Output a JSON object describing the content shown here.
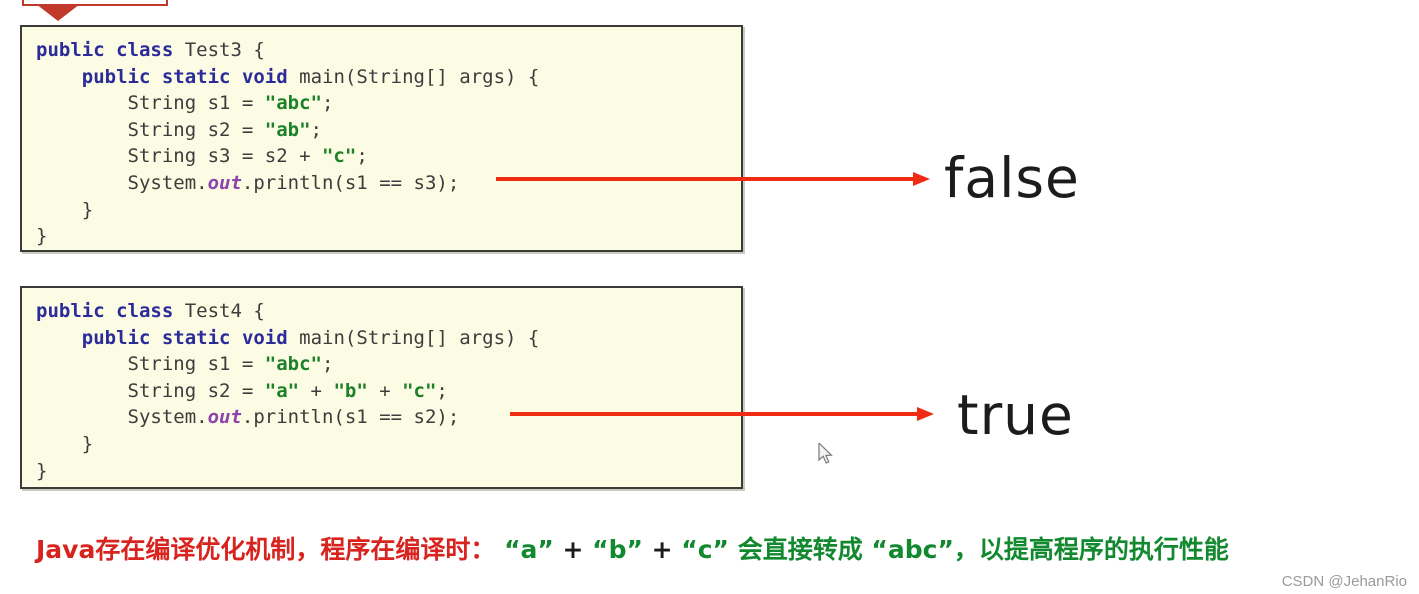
{
  "callout": {
    "name": "red-callout-banner"
  },
  "code_blocks": [
    {
      "id": "test3",
      "lines": [
        [
          {
            "t": "public",
            "c": "kw"
          },
          {
            "t": " ",
            "c": "pln"
          },
          {
            "t": "class",
            "c": "kw"
          },
          {
            "t": " Test3 {",
            "c": "pln"
          }
        ],
        [
          {
            "t": "    ",
            "c": "pln"
          },
          {
            "t": "public",
            "c": "kw"
          },
          {
            "t": " ",
            "c": "pln"
          },
          {
            "t": "static",
            "c": "kw"
          },
          {
            "t": " ",
            "c": "pln"
          },
          {
            "t": "void",
            "c": "kw"
          },
          {
            "t": " main(String[] args) {",
            "c": "pln"
          }
        ],
        [
          {
            "t": "        String s1 = ",
            "c": "pln"
          },
          {
            "t": "\"abc\"",
            "c": "str"
          },
          {
            "t": ";",
            "c": "pln"
          }
        ],
        [
          {
            "t": "        String s2 = ",
            "c": "pln"
          },
          {
            "t": "\"ab\"",
            "c": "str"
          },
          {
            "t": ";",
            "c": "pln"
          }
        ],
        [
          {
            "t": "        String s3 = s2 + ",
            "c": "pln"
          },
          {
            "t": "\"c\"",
            "c": "str"
          },
          {
            "t": ";",
            "c": "pln"
          }
        ],
        [
          {
            "t": "        System.",
            "c": "pln"
          },
          {
            "t": "out",
            "c": "fld"
          },
          {
            "t": ".println(s1 == s3);",
            "c": "pln"
          }
        ],
        [
          {
            "t": "    }",
            "c": "pln"
          }
        ],
        [
          {
            "t": "}",
            "c": "pln"
          }
        ]
      ]
    },
    {
      "id": "test4",
      "lines": [
        [
          {
            "t": "public",
            "c": "kw"
          },
          {
            "t": " ",
            "c": "pln"
          },
          {
            "t": "class",
            "c": "kw"
          },
          {
            "t": " Test4 {",
            "c": "pln"
          }
        ],
        [
          {
            "t": "    ",
            "c": "pln"
          },
          {
            "t": "public",
            "c": "kw"
          },
          {
            "t": " ",
            "c": "pln"
          },
          {
            "t": "static",
            "c": "kw"
          },
          {
            "t": " ",
            "c": "pln"
          },
          {
            "t": "void",
            "c": "kw"
          },
          {
            "t": " main(String[] args) {",
            "c": "pln"
          }
        ],
        [
          {
            "t": "        String s1 = ",
            "c": "pln"
          },
          {
            "t": "\"abc\"",
            "c": "str"
          },
          {
            "t": ";",
            "c": "pln"
          }
        ],
        [
          {
            "t": "        String s2 = ",
            "c": "pln"
          },
          {
            "t": "\"a\"",
            "c": "str"
          },
          {
            "t": " + ",
            "c": "pln"
          },
          {
            "t": "\"b\"",
            "c": "str"
          },
          {
            "t": " + ",
            "c": "pln"
          },
          {
            "t": "\"c\"",
            "c": "str"
          },
          {
            "t": ";",
            "c": "pln"
          }
        ],
        [
          {
            "t": "        System.",
            "c": "pln"
          },
          {
            "t": "out",
            "c": "fld"
          },
          {
            "t": ".println(s1 == s2);",
            "c": "pln"
          }
        ],
        [
          {
            "t": "    }",
            "c": "pln"
          }
        ],
        [
          {
            "t": "}",
            "c": "pln"
          }
        ]
      ]
    }
  ],
  "results": {
    "first": "false",
    "second": "true"
  },
  "arrows": {
    "first_label": "arrow-to-false",
    "second_label": "arrow-to-true"
  },
  "caption": {
    "segments": [
      {
        "t": "Java存在编译优化机制，程序在编译时：",
        "c": "red"
      },
      {
        "t": "  ",
        "c": "black"
      },
      {
        "t": "“a”",
        "c": "green"
      },
      {
        "t": " + ",
        "c": "black"
      },
      {
        "t": "“b”",
        "c": "green"
      },
      {
        "t": " + ",
        "c": "black"
      },
      {
        "t": "“c”",
        "c": "green"
      },
      {
        "t": " ",
        "c": "black"
      },
      {
        "t": "会直接转成",
        "c": "green"
      },
      {
        "t": " ",
        "c": "black"
      },
      {
        "t": "“abc”",
        "c": "green"
      },
      {
        "t": "，",
        "c": "green"
      },
      {
        "t": "以提高程序的执行性能",
        "c": "green"
      }
    ],
    "plain": "Java存在编译优化机制，程序在编译时： “a” + “b” + “c” 会直接转成 “abc”，以提高程序的执行性能"
  },
  "watermark": "CSDN @JehanRio",
  "colors": {
    "code_bg": "#fcfbe4",
    "code_border": "#3a3a36",
    "keyword": "#2b2b99",
    "string": "#1d8129",
    "field": "#8d44ad",
    "arrow_red": "#ef2b13",
    "caption_red": "#d8241f",
    "caption_green": "#13892f",
    "callout_red": "#c0392b"
  }
}
